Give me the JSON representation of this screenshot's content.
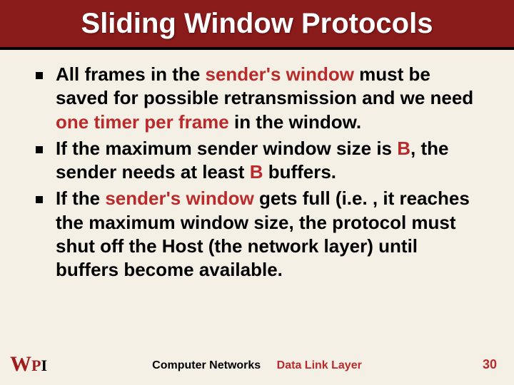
{
  "title": "Sliding Window Protocols",
  "bullets": [
    {
      "pre": "All frames in the ",
      "em1": "sender's window",
      "mid1": " must be saved for possible retransmission and we need ",
      "em2": "one timer per frame",
      "post": " in the window."
    },
    {
      "pre": "If the maximum sender window size is ",
      "em1": "B",
      "mid1": ", the sender needs at least ",
      "em2": "B",
      "post": " buffers."
    },
    {
      "pre": "If the ",
      "em1": "sender's window",
      "mid1": " gets full (i.e. , it reaches the maximum window size, the protocol must shut off the Host (the network layer) until buffers become available.",
      "em2": "",
      "post": ""
    }
  ],
  "footer": {
    "course": "Computer Networks",
    "topic": "Data Link Layer"
  },
  "logo": {
    "w": "W",
    "p": "P",
    "i": "I"
  },
  "slide_number": "30"
}
